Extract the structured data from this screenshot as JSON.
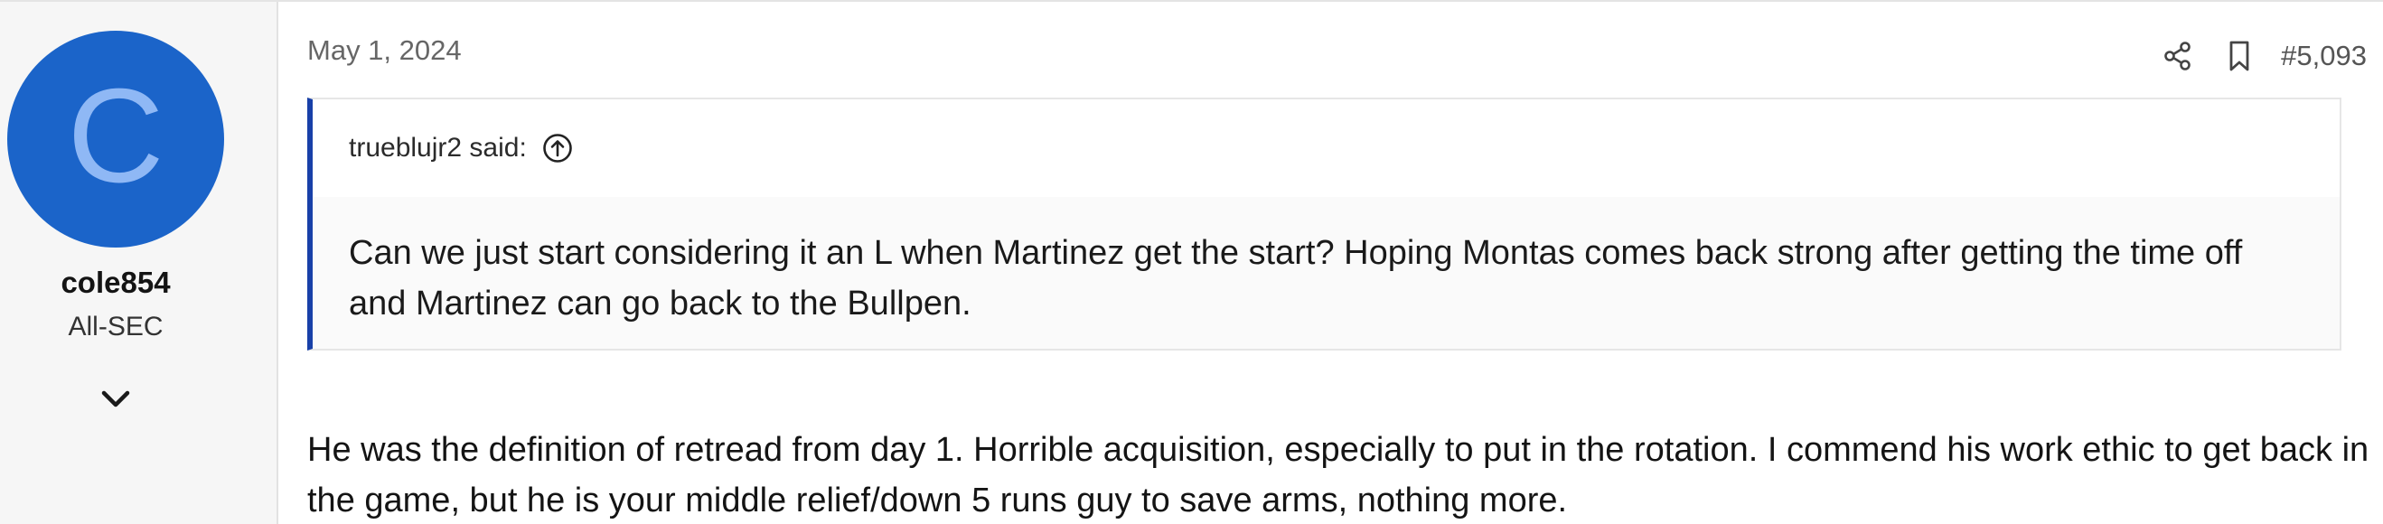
{
  "user": {
    "avatar_letter": "C",
    "avatar_color": "#1b64c9",
    "avatar_letter_color": "#8fb8f5",
    "name": "cole854",
    "title": "All-SEC",
    "expand_icon": "chevron-down-icon"
  },
  "post": {
    "date": "May 1, 2024",
    "number": "#5,093",
    "share_icon": "share-icon",
    "bookmark_icon": "bookmark-icon",
    "quote": {
      "author": "trueblujr2 said:",
      "jump_icon": "arrow-up-circle-icon",
      "text": "Can we just start considering it an L when Martinez get the start? Hoping Montas comes back strong after getting the time off and Martinez can go back to the Bullpen.",
      "accent_color": "#1840a8"
    },
    "body": "He was the definition of retread from day 1. Horrible acquisition, especially to put in the rotation. I commend his work ethic to get back in the game, but he is your middle relief/down 5 runs guy to save arms, nothing more."
  }
}
